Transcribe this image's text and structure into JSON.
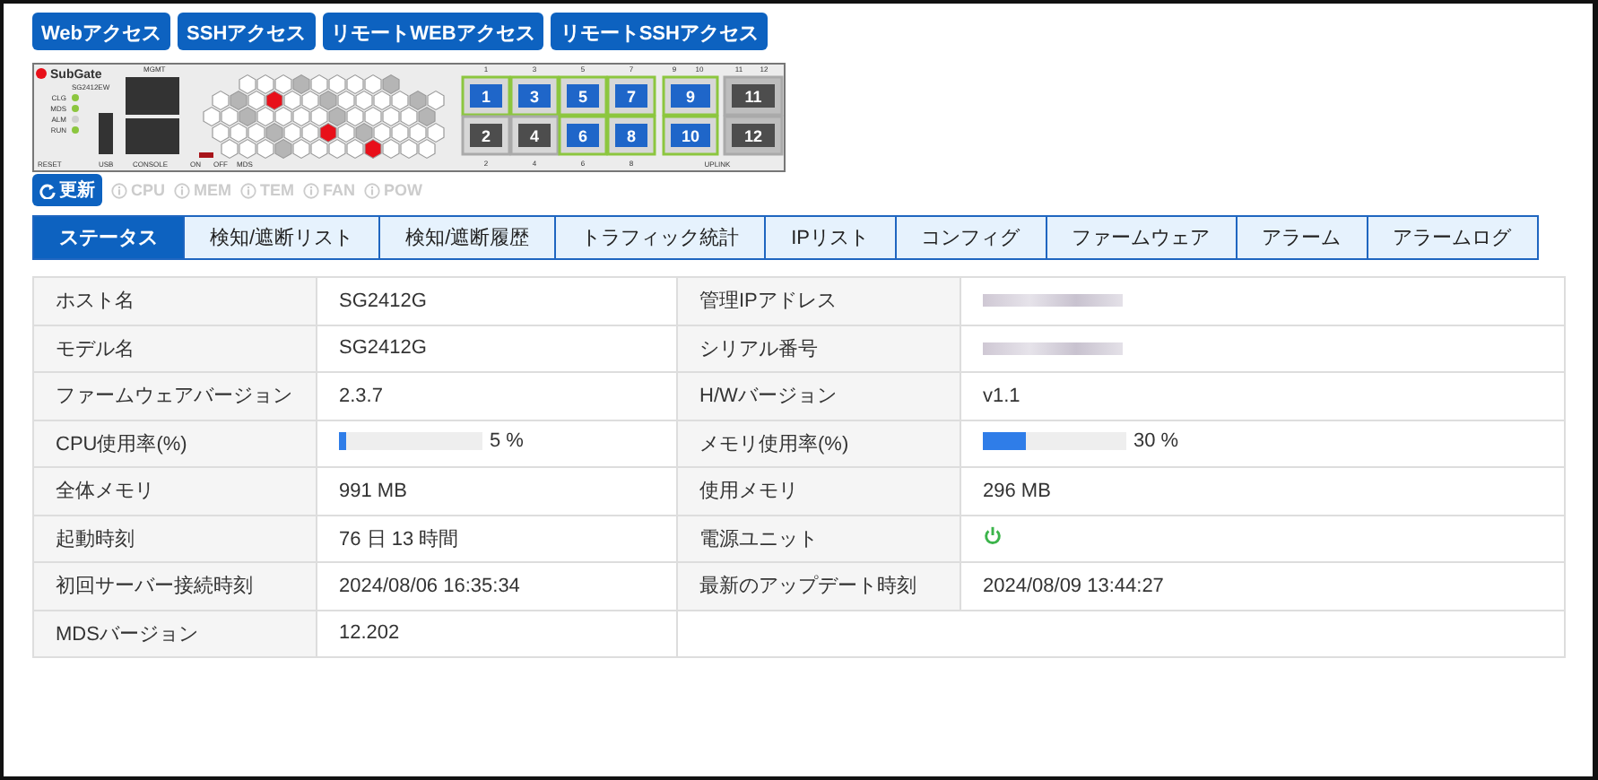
{
  "access_buttons": [
    "Webアクセス",
    "SSHアクセス",
    "リモートWEBアクセス",
    "リモートSSHアクセス"
  ],
  "device": {
    "brand": "SubGate",
    "model": "SG2412EW",
    "mgmt_label": "MGMT",
    "reset_label": "RESET",
    "usb_label": "USB",
    "console_label": "CONSOLE",
    "switch_labels": [
      "ON",
      "OFF",
      "MDS"
    ],
    "uplink_label": "UPLINK",
    "leds": [
      {
        "label": "CLG",
        "on": true
      },
      {
        "label": "MDS",
        "on": true
      },
      {
        "label": "ALM",
        "on": false
      },
      {
        "label": "RUN",
        "on": true
      }
    ],
    "ports": [
      {
        "number": "1",
        "caption": "1",
        "active": true,
        "kind": "rj45"
      },
      {
        "number": "2",
        "caption": "2",
        "active": false,
        "kind": "rj45"
      },
      {
        "number": "3",
        "caption": "3",
        "active": true,
        "kind": "rj45"
      },
      {
        "number": "4",
        "caption": "4",
        "active": false,
        "kind": "rj45"
      },
      {
        "number": "5",
        "caption": "5",
        "active": true,
        "kind": "rj45"
      },
      {
        "number": "6",
        "caption": "6",
        "active": true,
        "kind": "rj45"
      },
      {
        "number": "7",
        "caption": "7",
        "active": true,
        "kind": "rj45"
      },
      {
        "number": "8",
        "caption": "8",
        "active": true,
        "kind": "rj45"
      },
      {
        "number": "9",
        "caption": "9",
        "active": true,
        "kind": "rj45"
      },
      {
        "number": "10",
        "caption": "10",
        "active": true,
        "kind": "rj45"
      },
      {
        "number": "11",
        "caption": "11",
        "active": false,
        "kind": "sfp"
      },
      {
        "number": "12",
        "caption": "12",
        "active": false,
        "kind": "sfp"
      }
    ]
  },
  "refresh_button": "更新",
  "indicators": [
    {
      "label": "CPU",
      "active": false
    },
    {
      "label": "MEM",
      "active": false
    },
    {
      "label": "TEM",
      "active": false
    },
    {
      "label": "FAN",
      "active": false
    },
    {
      "label": "POW",
      "active": false
    }
  ],
  "tabs": [
    {
      "label": "ステータス",
      "selected": true
    },
    {
      "label": "検知/遮断リスト",
      "selected": false
    },
    {
      "label": "検知/遮断履歴",
      "selected": false
    },
    {
      "label": "トラフィック統計",
      "selected": false
    },
    {
      "label": "IPリスト",
      "selected": false
    },
    {
      "label": "コンフィグ",
      "selected": false
    },
    {
      "label": "ファームウェア",
      "selected": false
    },
    {
      "label": "アラーム",
      "selected": false
    },
    {
      "label": "アラームログ",
      "selected": false
    }
  ],
  "rows": [
    {
      "cells": [
        {
          "label": "ホスト名",
          "kind": "text",
          "value": "SG2412G"
        },
        {
          "label": "管理IPアドレス",
          "kind": "masked"
        }
      ]
    },
    {
      "cells": [
        {
          "label": "モデル名",
          "kind": "text",
          "value": "SG2412G"
        },
        {
          "label": "シリアル番号",
          "kind": "masked"
        }
      ]
    },
    {
      "cells": [
        {
          "label": "ファームウェアバージョン",
          "kind": "text",
          "value": "2.3.7"
        },
        {
          "label": "H/Wバージョン",
          "kind": "text",
          "value": "v1.1"
        }
      ]
    },
    {
      "cells": [
        {
          "label": "CPU使用率(%)",
          "kind": "bar",
          "level": 0.05,
          "reading": "5 %"
        },
        {
          "label": "メモリ使用率(%)",
          "kind": "bar",
          "level": 0.3,
          "reading": "30 %"
        }
      ]
    },
    {
      "cells": [
        {
          "label": "全体メモリ",
          "kind": "text",
          "value": "991 MB"
        },
        {
          "label": "使用メモリ",
          "kind": "text",
          "value": "296 MB"
        }
      ]
    },
    {
      "cells": [
        {
          "label": "起動時刻",
          "kind": "text",
          "value": "76 日 13 時間"
        },
        {
          "label": "電源ユニット",
          "kind": "power",
          "on": true
        }
      ]
    },
    {
      "cells": [
        {
          "label": "初回サーバー接続時刻",
          "kind": "text",
          "value": "2024/08/06 16:35:34"
        },
        {
          "label": "最新のアップデート時刻",
          "kind": "text",
          "value": "2024/08/09 13:44:27"
        }
      ]
    },
    {
      "cells": [
        {
          "label": "MDSバージョン",
          "kind": "text",
          "value": "12.202"
        }
      ]
    }
  ]
}
